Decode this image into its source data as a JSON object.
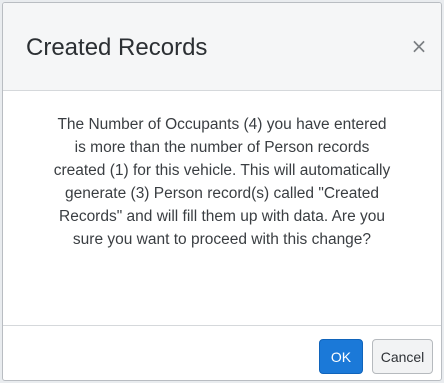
{
  "dialog": {
    "title": "Created Records",
    "close_symbol": "×",
    "message_lines": [
      "The Number of Occupants (4) you have entered",
      "is more than the number of Person records",
      "created (1) for this vehicle. This will automatically",
      "generate (3) Person record(s) called \"Created",
      "Records\" and will fill them up with data. Are you",
      "sure you want to proceed with this change?"
    ],
    "ok_label": "OK",
    "cancel_label": "Cancel"
  },
  "colors": {
    "primary_button": "#1b79d8",
    "header_background": "#f5f6f7",
    "text": "#3a3e42"
  },
  "icons": {
    "close": "close-icon"
  }
}
